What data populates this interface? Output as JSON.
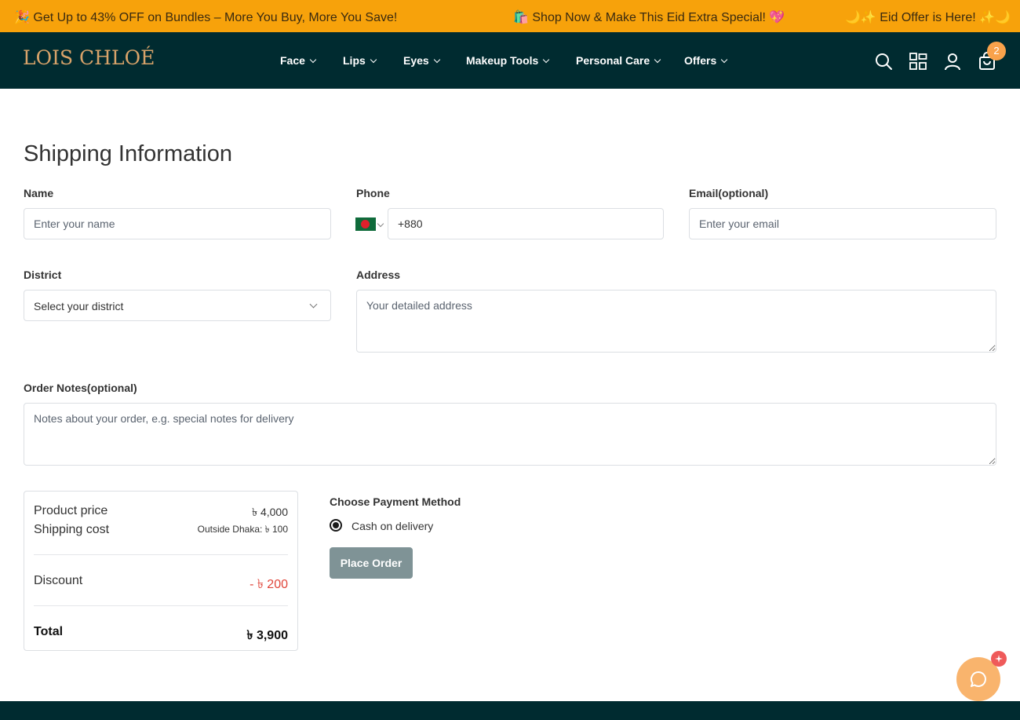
{
  "promo": {
    "left": "🎉 Get Up to 43% OFF on Bundles – More You Buy, More You Save!",
    "middle": "🛍️ Shop Now & Make This Eid Extra Special! 💖",
    "right": "🌙✨ Eid Offer is Here! ✨🌙",
    "bg": "#f7a20b"
  },
  "nav": {
    "logo": "LOIS CHLOÉ",
    "bg": "#002b30",
    "menu": [
      {
        "label": "Face"
      },
      {
        "label": "Lips"
      },
      {
        "label": "Eyes"
      },
      {
        "label": "Makeup Tools"
      },
      {
        "label": "Personal Care"
      },
      {
        "label": "Offers"
      }
    ],
    "icons": [
      "search-icon",
      "grid-icon",
      "user-icon",
      "cart-icon"
    ],
    "cart_count": "2"
  },
  "form": {
    "title": "Shipping Information",
    "name": {
      "label": "Name",
      "placeholder": "Enter your name",
      "value": ""
    },
    "phone": {
      "label": "Phone",
      "value": "+880",
      "country_flag": "flag-bd-icon"
    },
    "email": {
      "label": "Email(optional)",
      "placeholder": "Enter your email",
      "value": ""
    },
    "district": {
      "label": "District",
      "selected": "Select your district"
    },
    "address": {
      "label": "Address",
      "placeholder": "Your detailed address"
    },
    "notes": {
      "label": "Order Notes(optional)",
      "placeholder": "Notes about your order, e.g. special notes for delivery"
    }
  },
  "summary": {
    "product_price_label": "Product price",
    "product_price_value": "৳ 4,000",
    "shipping_label": "Shipping cost",
    "shipping_value": "Outside Dhaka: ৳ 100",
    "discount_label": "Discount",
    "discount_value": "- ৳ 200",
    "total_label": "Total",
    "total_value": "৳ 3,900",
    "discount_color": "#e0453a"
  },
  "payment": {
    "title": "Choose Payment Method",
    "option": "Cash on delivery",
    "selected": true,
    "place_order": "Place Order"
  },
  "chat": {
    "icon": "chat-icon",
    "accent": "#f9b46d"
  }
}
